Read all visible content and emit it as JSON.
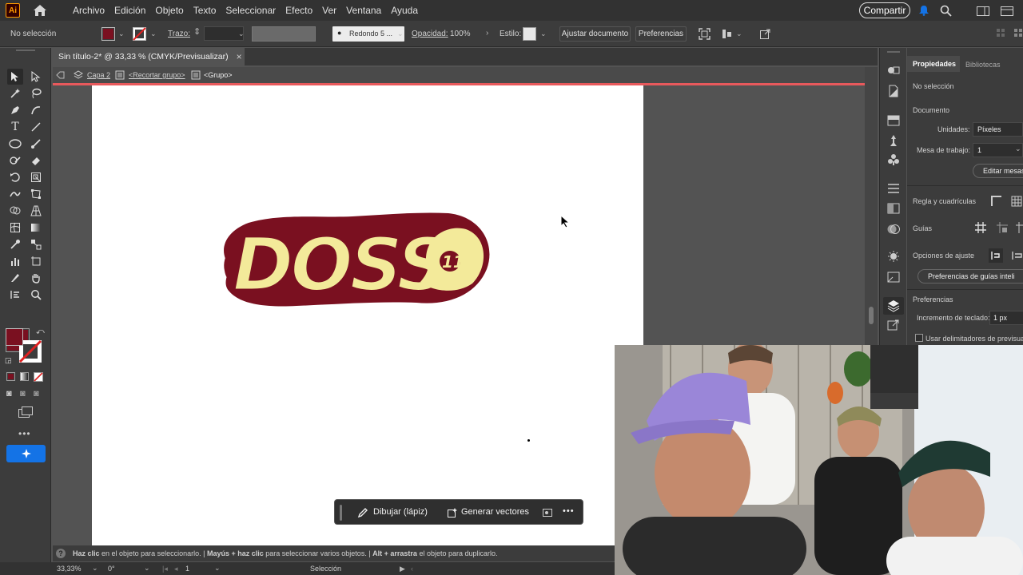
{
  "app": {
    "logo": "Ai"
  },
  "menu": [
    "Archivo",
    "Edición",
    "Objeto",
    "Texto",
    "Seleccionar",
    "Efecto",
    "Ver",
    "Ventana",
    "Ayuda"
  ],
  "share_label": "Compartir",
  "control": {
    "selection": "No selección",
    "stroke_label": "Trazo:",
    "brush": "Redondo 5 ...",
    "opacity_label": "Opacidad:",
    "opacity_value": "100%",
    "style_label": "Estilo:",
    "fit_document": "Ajustar documento",
    "preferences": "Preferencias"
  },
  "colors": {
    "fill": "#7a1020",
    "logo_fill": "#f3ea9a",
    "logo_outline": "#7a1020",
    "accent": "#1473e6",
    "isolation": "#e8595c"
  },
  "document_tab": {
    "title": "Sin título-2* @ 33,33 % (CMYK/Previsualizar)",
    "close": "×"
  },
  "breadcrumb": {
    "layer": "Capa 2",
    "clip_group": "<Recortar grupo>",
    "group": "<Grupo>"
  },
  "logo": {
    "text": "DOSS",
    "badge": "11"
  },
  "context_bar": {
    "draw": "Dibujar (lápiz)",
    "generate": "Generar vectores",
    "more": "•••"
  },
  "properties": {
    "tabs": [
      "Propiedades",
      "Bibliotecas"
    ],
    "no_selection": "No selección",
    "document": "Documento",
    "units_label": "Unidades:",
    "units_value": "Píxeles",
    "artboard_label": "Mesa de trabajo:",
    "artboard_value": "1",
    "edit_artboards": "Editar mesas",
    "rulers": "Regla y cuadrículas",
    "guides": "Guías",
    "snap": "Opciones de ajuste",
    "smart_guides": "Preferencias de guías inteli",
    "preferences": "Preferencias",
    "keyboard_label": "Incremento de teclado:",
    "keyboard_value": "1 px",
    "preview_bounds": "Usar delimitadores de previsual"
  },
  "hint": {
    "part1": "Haz clic",
    "part2": " en el objeto para seleccionarlo.  | ",
    "part3": "Mayús + haz clic",
    "part4": " para seleccionar varios objetos.  | ",
    "part5": "Alt + arrastra",
    "part6": " el objeto para duplicarlo."
  },
  "status": {
    "zoom": "33,33%",
    "rotation": "0°",
    "artboard": "1",
    "mode": "Selección"
  }
}
